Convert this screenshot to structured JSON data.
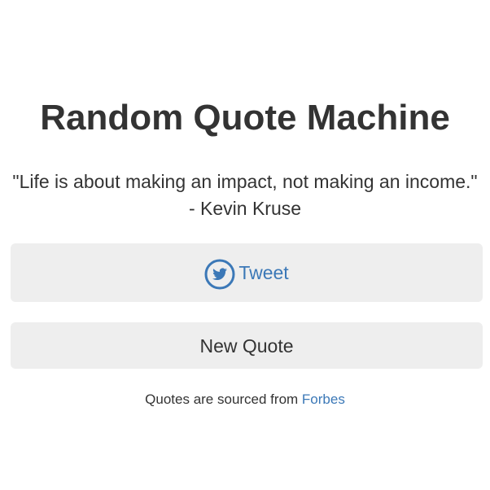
{
  "title": "Random Quote Machine",
  "quote": {
    "text": "\"Life is about making an impact, not making an income.\"",
    "author": "- Kevin Kruse"
  },
  "buttons": {
    "tweet_label": "Tweet",
    "tweet_icon": "twitter-icon",
    "new_quote_label": "New Quote"
  },
  "source": {
    "prefix": "Quotes are sourced from ",
    "link_label": "Forbes"
  },
  "colors": {
    "text": "#333333",
    "link": "#3b78b7",
    "button_bg": "#eeeeee",
    "background": "#ffffff"
  }
}
